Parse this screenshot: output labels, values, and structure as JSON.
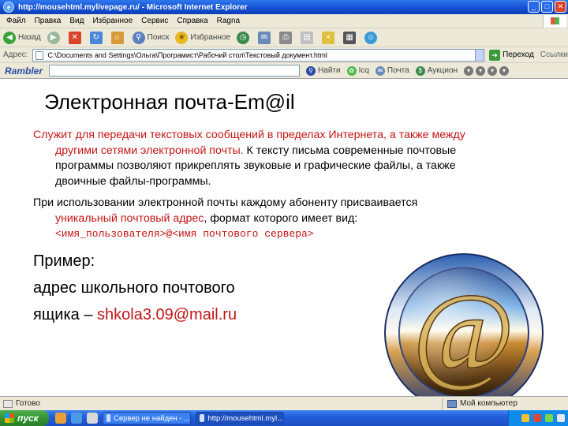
{
  "window": {
    "title": "http://mousehtml.mylivepage.ru/ - Microsoft Internet Explorer",
    "btn_minimize": "_",
    "btn_maximize": "□",
    "btn_close": "✕"
  },
  "menu": [
    "Файл",
    "Правка",
    "Вид",
    "Избранное",
    "Сервис",
    "Справка",
    "Ragna"
  ],
  "toolbar": {
    "back": "Назад",
    "search": "Поиск",
    "favorites": "Избранное"
  },
  "address": {
    "label": "Адрес:",
    "value": "C:\\Documents and Settings\\Ольга\\Програмист\\Рабочий стол\\Текстовый документ.html",
    "go": "Переход",
    "links": "Ссылки"
  },
  "rambler": {
    "logo": "Rambler",
    "find": "Найти",
    "icq": "Icq",
    "mail": "Почта",
    "auction": "Аукцион"
  },
  "content": {
    "title": "Электронная почта-Em@il",
    "p1_l1": "Служит для передачи текстовых сообщений в пределах Интернета, а также между",
    "p1_l2_red": "другими сетями электронной почты.",
    "p1_l2_black": " К тексту письма современные почтовые",
    "p1_l3": "программы позволяют прикреплять звуковые и графические файлы, а также",
    "p1_l4": "двоичные файлы-программы.",
    "p2_l1": "При использовании электронной почты каждому абоненту присваивается",
    "p2_l2_red": "уникальный почтовый адрес",
    "p2_l2_black": ", формат которого имеет вид:",
    "p2_l3": "<имя_пользователя>@<имя почтового сервера>",
    "example_label": "Пример:",
    "example_l2": "адрес школьного почтового",
    "example_l3_prefix": "ящика – ",
    "example_email": "shkola3.09@mail.ru",
    "orb_symbol": "@"
  },
  "status": {
    "left": "Готово",
    "right": "Мой компьютер"
  },
  "taskbar": {
    "start": "пуск",
    "tasks": [
      "Сервер не найден - ...",
      "http://mousehtml.myl..."
    ]
  }
}
